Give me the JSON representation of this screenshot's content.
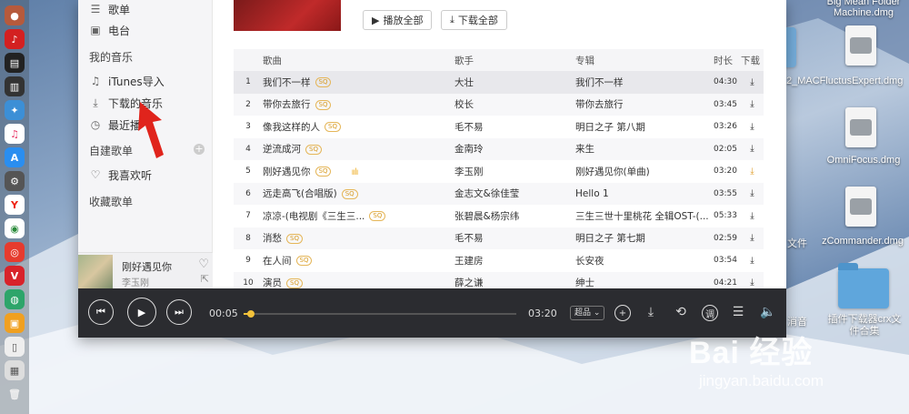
{
  "sidebar": {
    "top_items": [
      {
        "label": "歌单",
        "icon": "playlist-icon"
      },
      {
        "label": "电台",
        "icon": "radio-icon"
      }
    ],
    "my_music_title": "我的音乐",
    "my_music_items": [
      {
        "label": "iTunes导入",
        "icon": "itunes-icon"
      },
      {
        "label": "下载的音乐",
        "icon": "download-icon"
      },
      {
        "label": "最近播",
        "icon": "clock-icon"
      }
    ],
    "created_playlists_title": "自建歌单",
    "favorites_label": "我喜欢听",
    "collected_playlists_title": "收藏歌单",
    "now_playing": {
      "title": "刚好遇见你",
      "artist": "李玉刚"
    }
  },
  "actions": {
    "play_all": "播放全部",
    "download_all": "下载全部"
  },
  "table": {
    "headers": {
      "title": "歌曲",
      "artist": "歌手",
      "album": "专辑",
      "duration": "时长",
      "download": "下载"
    },
    "quality_badge": "SQ",
    "rows": [
      {
        "idx": "1",
        "title": "我们不一样",
        "artist": "大壮",
        "album": "我们不一样",
        "duration": "04:30"
      },
      {
        "idx": "2",
        "title": "带你去旅行",
        "artist": "校长",
        "album": "带你去旅行",
        "duration": "03:45"
      },
      {
        "idx": "3",
        "title": "像我这样的人",
        "artist": "毛不易",
        "album": "明日之子 第八期",
        "duration": "03:26"
      },
      {
        "idx": "4",
        "title": "逆流成河",
        "artist": "金南玲",
        "album": "来生",
        "duration": "02:05"
      },
      {
        "idx": "5",
        "title": "刚好遇见你",
        "artist": "李玉刚",
        "album": "刚好遇见你(单曲)",
        "duration": "03:20"
      },
      {
        "idx": "6",
        "title": "远走高飞(合唱版)",
        "artist": "金志文&徐佳莹",
        "album": "Hello 1",
        "duration": "03:55"
      },
      {
        "idx": "7",
        "title": "凉凉-(电视剧《三生三...",
        "artist": "张碧晨&杨宗纬",
        "album": "三生三世十里桃花 全辑OST-(...",
        "duration": "05:33"
      },
      {
        "idx": "8",
        "title": "消愁",
        "artist": "毛不易",
        "album": "明日之子 第七期",
        "duration": "02:59"
      },
      {
        "idx": "9",
        "title": "在人间",
        "artist": "王建房",
        "album": "长安夜",
        "duration": "03:54"
      },
      {
        "idx": "10",
        "title": "演员",
        "artist": "薛之谦",
        "album": "绅士",
        "duration": "04:21"
      }
    ]
  },
  "player": {
    "elapsed": "00:05",
    "total": "03:20",
    "progress": 0.025,
    "quality": "超品",
    "accent_color": "#f3c23a"
  },
  "desktop": {
    "labels": {
      "bigmean": "Big Mean Folder Machine.dmg",
      "fluctus": "FluctusExpert.dmg",
      "omnifocus": "OmniFocus.dmg",
      "zcommander": "zCommander.dmg",
      "plugin_folder": "插件下载器crx文件合集",
      "partial_mac": "2_MAC",
      "partial_file": "文件",
      "partial_sound": "消音"
    }
  },
  "watermark": {
    "logo": "Bai 经验",
    "url": "jingyan.baidu.com"
  }
}
